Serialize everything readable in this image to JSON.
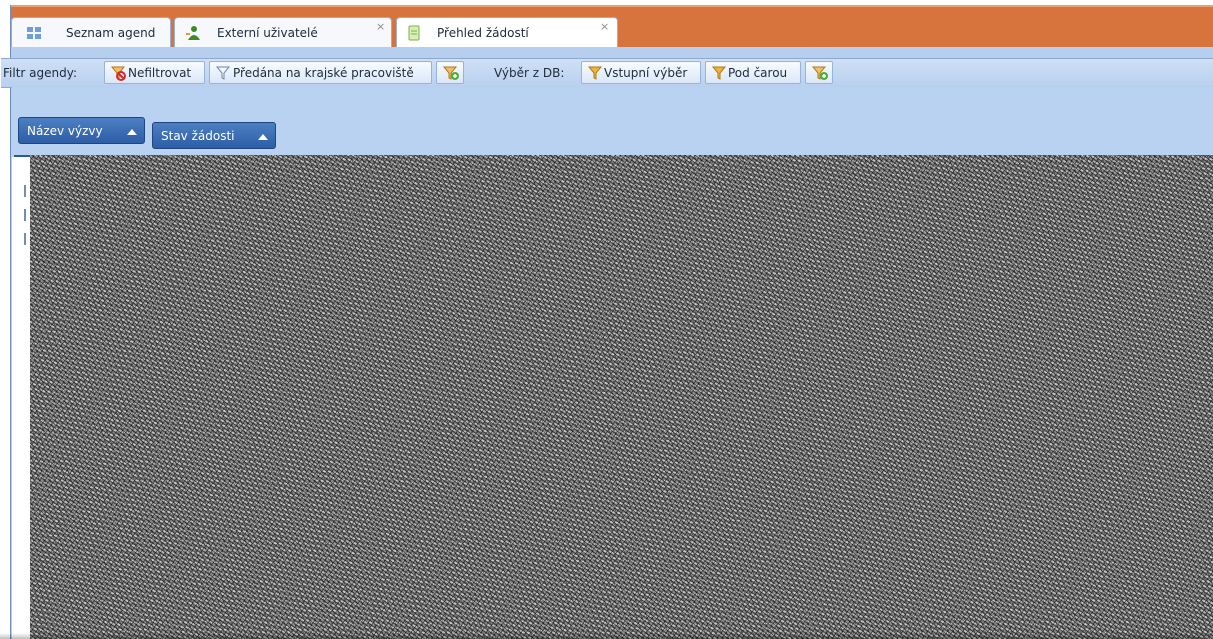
{
  "tabs": [
    {
      "label": "Seznam agend",
      "icon": "grid-icon",
      "closable": false,
      "active": false
    },
    {
      "label": "Externí uživatelé",
      "icon": "user-add-icon",
      "closable": true,
      "active": false
    },
    {
      "label": "Přehled žádostí",
      "icon": "document-icon",
      "closable": true,
      "active": true
    }
  ],
  "toolbar": {
    "filter_label": "Filtr agendy:",
    "no_filter": "Nefiltrovat",
    "forwarded": "Předána na krajské pracoviště",
    "db_label": "Výběr z DB:",
    "input_selection": "Vstupní výběr",
    "below_line": "Pod čarou"
  },
  "grouping": [
    {
      "label": "Název výzvy"
    },
    {
      "label": "Stav žádosti"
    }
  ],
  "colors": {
    "accent": "#d7733c",
    "toolbar": "#c4d8f2",
    "chip": "#3a6cb3"
  }
}
